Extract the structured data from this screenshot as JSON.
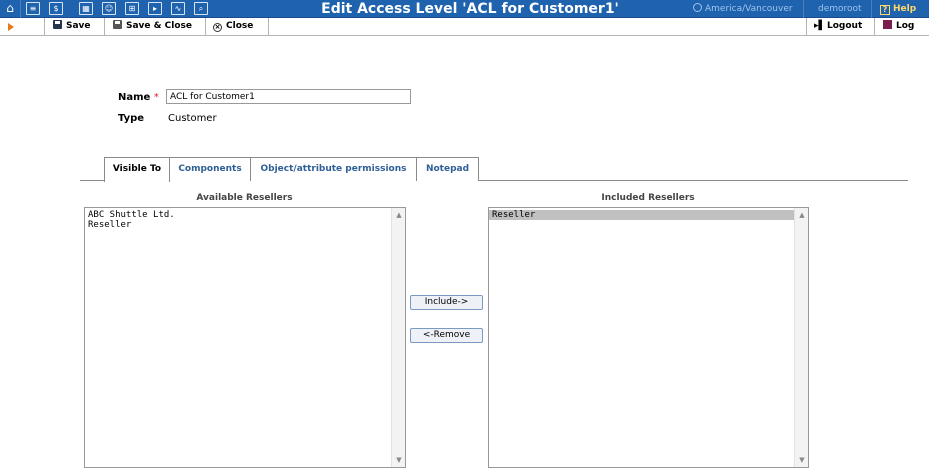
{
  "app": {
    "title": "Edit Access Level 'ACL for Customer1'",
    "timezone": "America/Vancouver",
    "user": "demoroot",
    "help": "Help"
  },
  "toolbar": {
    "save": "Save",
    "save_close": "Save & Close",
    "close": "Close",
    "logout": "Logout",
    "log": "Log"
  },
  "form": {
    "name_label": "Name",
    "name_required": "*",
    "name_value": "ACL for Customer1",
    "type_label": "Type",
    "type_value": "Customer"
  },
  "tabs": [
    "Visible To",
    "Components",
    "Object/attribute permissions",
    "Notepad"
  ],
  "available": {
    "title": "Available Resellers",
    "items": [
      "ABC Shuttle Ltd.",
      "Reseller"
    ]
  },
  "included": {
    "title": "Included Resellers",
    "items": [
      "Reseller"
    ]
  },
  "buttons": {
    "include": "Include->",
    "remove": "<-Remove"
  },
  "colors": {
    "topbar": "#1f62ae",
    "link": "#2f5f97",
    "selected": "#c0c0c0"
  }
}
